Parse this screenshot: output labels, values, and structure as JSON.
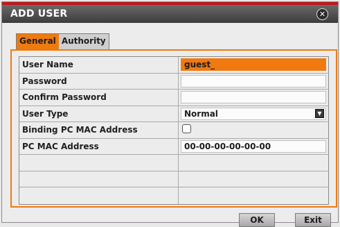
{
  "dialog": {
    "title": "ADD USER",
    "close_icon": "close-icon",
    "tabs": [
      {
        "label": "General",
        "active": true
      },
      {
        "label": "Authority",
        "active": false
      }
    ],
    "fields": [
      {
        "label": "User Name",
        "value": "guest_",
        "type": "text"
      },
      {
        "label": "Password",
        "value": "",
        "type": "password"
      },
      {
        "label": "Confirm Password",
        "value": "",
        "type": "password"
      },
      {
        "label": "User Type",
        "value": "Normal",
        "type": "select"
      },
      {
        "label": "Binding PC MAC Address",
        "checked": false,
        "type": "checkbox"
      },
      {
        "label": "PC MAC Address",
        "value": "00-00-00-00-00-00",
        "type": "text"
      }
    ],
    "buttons": {
      "ok": "OK",
      "exit": "Exit"
    },
    "colors": {
      "accent": "#ee7b0f",
      "title_bar": "#4a4a4a",
      "title_border": "#c4161c"
    }
  }
}
